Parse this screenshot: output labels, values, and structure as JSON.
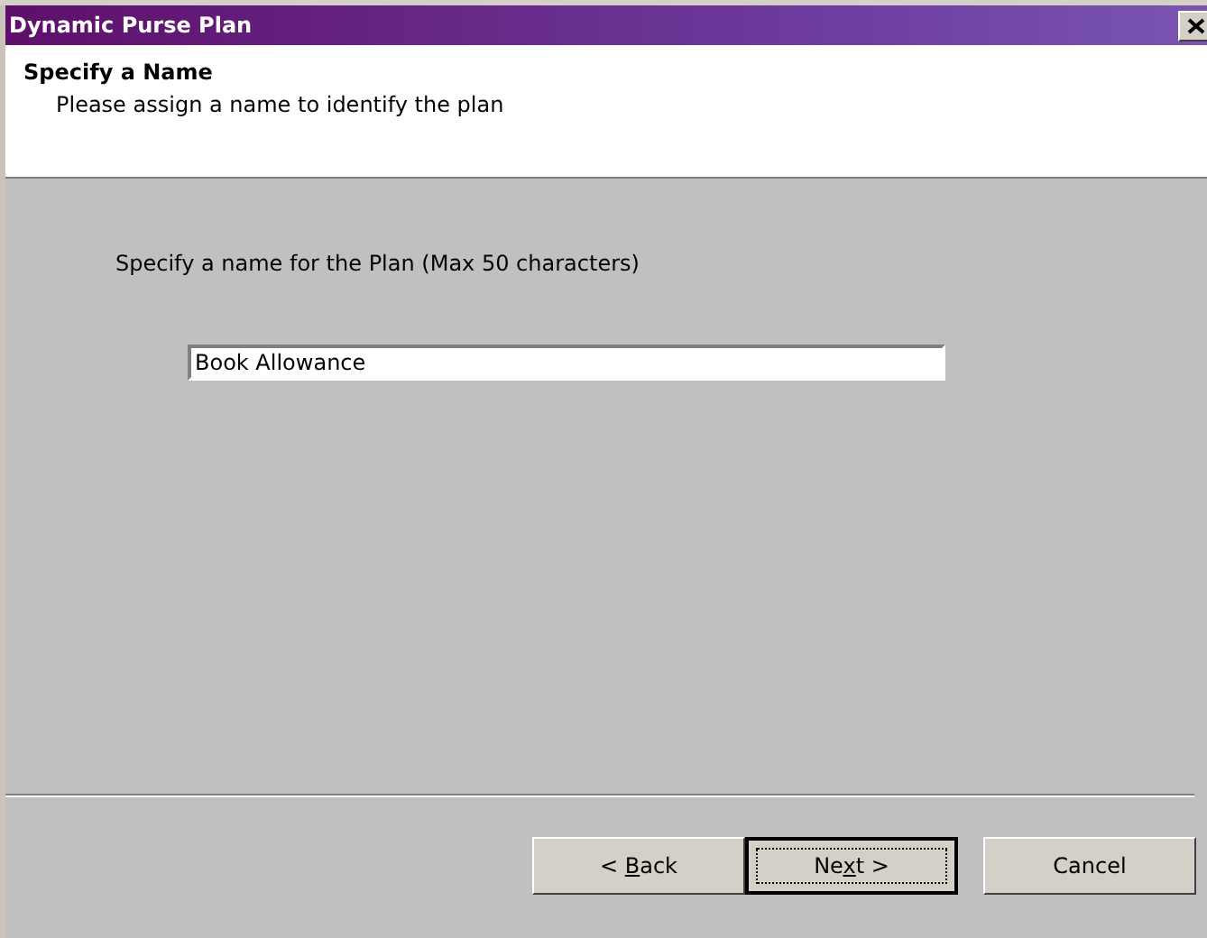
{
  "window": {
    "title": "Dynamic Purse Plan"
  },
  "header": {
    "title": "Specify a Name",
    "subtitle": "Please assign a name to identify the plan"
  },
  "name_field": {
    "label": "Specify a name for the Plan (Max 50 characters)",
    "value": "Book Allowance"
  },
  "buttons": [
    {
      "text_before": "< ",
      "access_key": "B",
      "text_after": "ack",
      "focused": false
    },
    {
      "text_before": "Ne",
      "access_key": "x",
      "text_after": "t >",
      "focused": true
    },
    {
      "text_before": "Cancel",
      "focused": false
    }
  ]
}
